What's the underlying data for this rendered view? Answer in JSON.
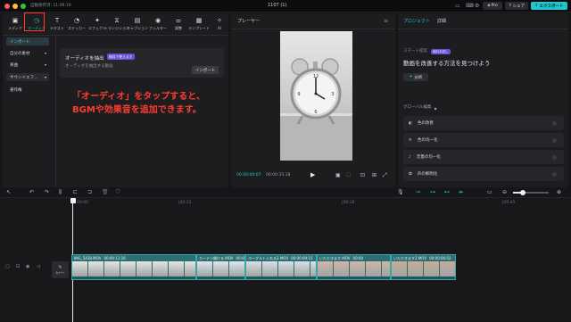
{
  "titlebar": {
    "autosave": "自動保存済: 11:09:19",
    "project_title": "1107 (1)",
    "pro_label": "Pro",
    "share_label": "シェア",
    "export_label": "エクスポート"
  },
  "tabs": [
    {
      "icon": "media-icon",
      "glyph": "▣",
      "label": "メディア"
    },
    {
      "icon": "audio-icon",
      "glyph": "◷",
      "label": "オーディオ"
    },
    {
      "icon": "text-icon",
      "glyph": "T",
      "label": "テキスト"
    },
    {
      "icon": "sticker-icon",
      "glyph": "◔",
      "label": "ステッカー"
    },
    {
      "icon": "effect-icon",
      "glyph": "✦",
      "label": "エフェクト"
    },
    {
      "icon": "transition-icon",
      "glyph": "⧖",
      "label": "トランジション"
    },
    {
      "icon": "caption-icon",
      "glyph": "▤",
      "label": "キャプション"
    },
    {
      "icon": "filter-icon",
      "glyph": "◉",
      "label": "フィルター"
    },
    {
      "icon": "adjust-icon",
      "glyph": "⚌",
      "label": "調整"
    },
    {
      "icon": "template-icon",
      "glyph": "▦",
      "label": "テンプレート"
    },
    {
      "icon": "ai-icon",
      "glyph": "✧",
      "label": "AI"
    }
  ],
  "sidebar": {
    "import": "インポート",
    "mine": "自分の素材",
    "music": "楽曲",
    "sound": "サウンドエフ...",
    "copyright": "著作権"
  },
  "extract": {
    "title": "オーディオを抽出",
    "badge": "無料で使えます",
    "desc": "オーディオを抽出する動画",
    "import_btn": "インポート"
  },
  "annotation": {
    "line1": "「オーディオ」をタップすると、",
    "line2": "BGMや効果音を追加できます。",
    "color": "#ff3b30"
  },
  "player": {
    "title": "プレーヤー",
    "current": "00:00:00:07",
    "total": "00:00:35:18"
  },
  "right": {
    "tab_project": "プロジェクト",
    "tab_detail": "詳細",
    "smart_label": "スマート提案",
    "smart_badge": "無料お試し",
    "smart_title": "動画を改善する方法を見つけよう",
    "analyze": "分析",
    "global_label": "グローバル編集",
    "items": [
      "色の改善",
      "色の均一化",
      "音量の均一化",
      "声の鮮明化"
    ]
  },
  "ruler": {
    "t0": "00:00",
    "t1": "|00:15",
    "t2": "|00:30",
    "t3": "|00:45"
  },
  "cover_label": "カバー",
  "clips": [
    {
      "name": "IMG_5438.MOV",
      "duration": "00:00:11:16"
    },
    {
      "name": "カーテン開ける.MOV",
      "duration": "00:00"
    },
    {
      "name": "ヨーグルト入れる2.MOV",
      "duration": "00:00:09:15"
    },
    {
      "name": "いただきます.MOV",
      "duration": "00:00"
    },
    {
      "name": "いただきます2.MOV",
      "duration": "00:00:06:02"
    }
  ],
  "accent": "#1fc6cf"
}
